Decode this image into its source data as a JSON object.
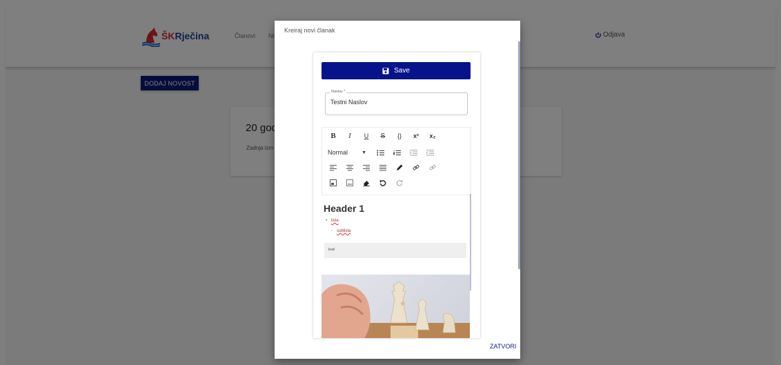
{
  "header": {
    "logo_text_a": "ŠK",
    "logo_text_b": "Rječina",
    "nav": [
      "Članovi",
      "No"
    ],
    "logout_label": "Odjava",
    "logout_icon": "power-icon"
  },
  "page": {
    "add_button_label": "DODAJ NOVOST",
    "card_title": "20 god",
    "card_subtitle": "Zadnja izm"
  },
  "dialog": {
    "title": "Kreiraj novi članak",
    "save_label": "Save",
    "save_icon": "floppy-disk-icon",
    "field_label": "Naslov *",
    "field_value": "Testni Naslov",
    "close_label": "ZATVORI",
    "toolbar": {
      "row1": [
        {
          "glyph": "B",
          "icon": "bold-icon"
        },
        {
          "glyph": "I",
          "icon": "italic-icon"
        },
        {
          "glyph": "U",
          "icon": "underline-icon"
        },
        {
          "glyph": "S",
          "icon": "strikethrough-icon"
        },
        {
          "glyph": "{}",
          "icon": "code-icon"
        },
        {
          "glyph": "x²",
          "icon": "superscript-icon"
        },
        {
          "glyph": "x₂",
          "icon": "subscript-icon"
        }
      ],
      "format_value": "Normal",
      "row2_icons": [
        "bulleted-list-icon",
        "numbered-list-icon",
        "indent-increase-icon",
        "indent-decrease-icon"
      ],
      "row3_icons": [
        "align-left-icon",
        "align-center-icon",
        "align-right-icon",
        "align-justify-icon",
        "pencil-icon",
        "link-icon",
        "unlink-icon"
      ],
      "row4_icons": [
        "embed-icon",
        "image-icon",
        "eraser-icon",
        "undo-icon",
        "redo-icon"
      ]
    },
    "editor": {
      "heading": "Header 1",
      "list_item": "lista",
      "sub_list_item": "sublista",
      "code_text": "kod"
    }
  },
  "colors": {
    "primary": "#06138a",
    "brand_red": "#d9282f",
    "brand_blue": "#1f3f99"
  }
}
